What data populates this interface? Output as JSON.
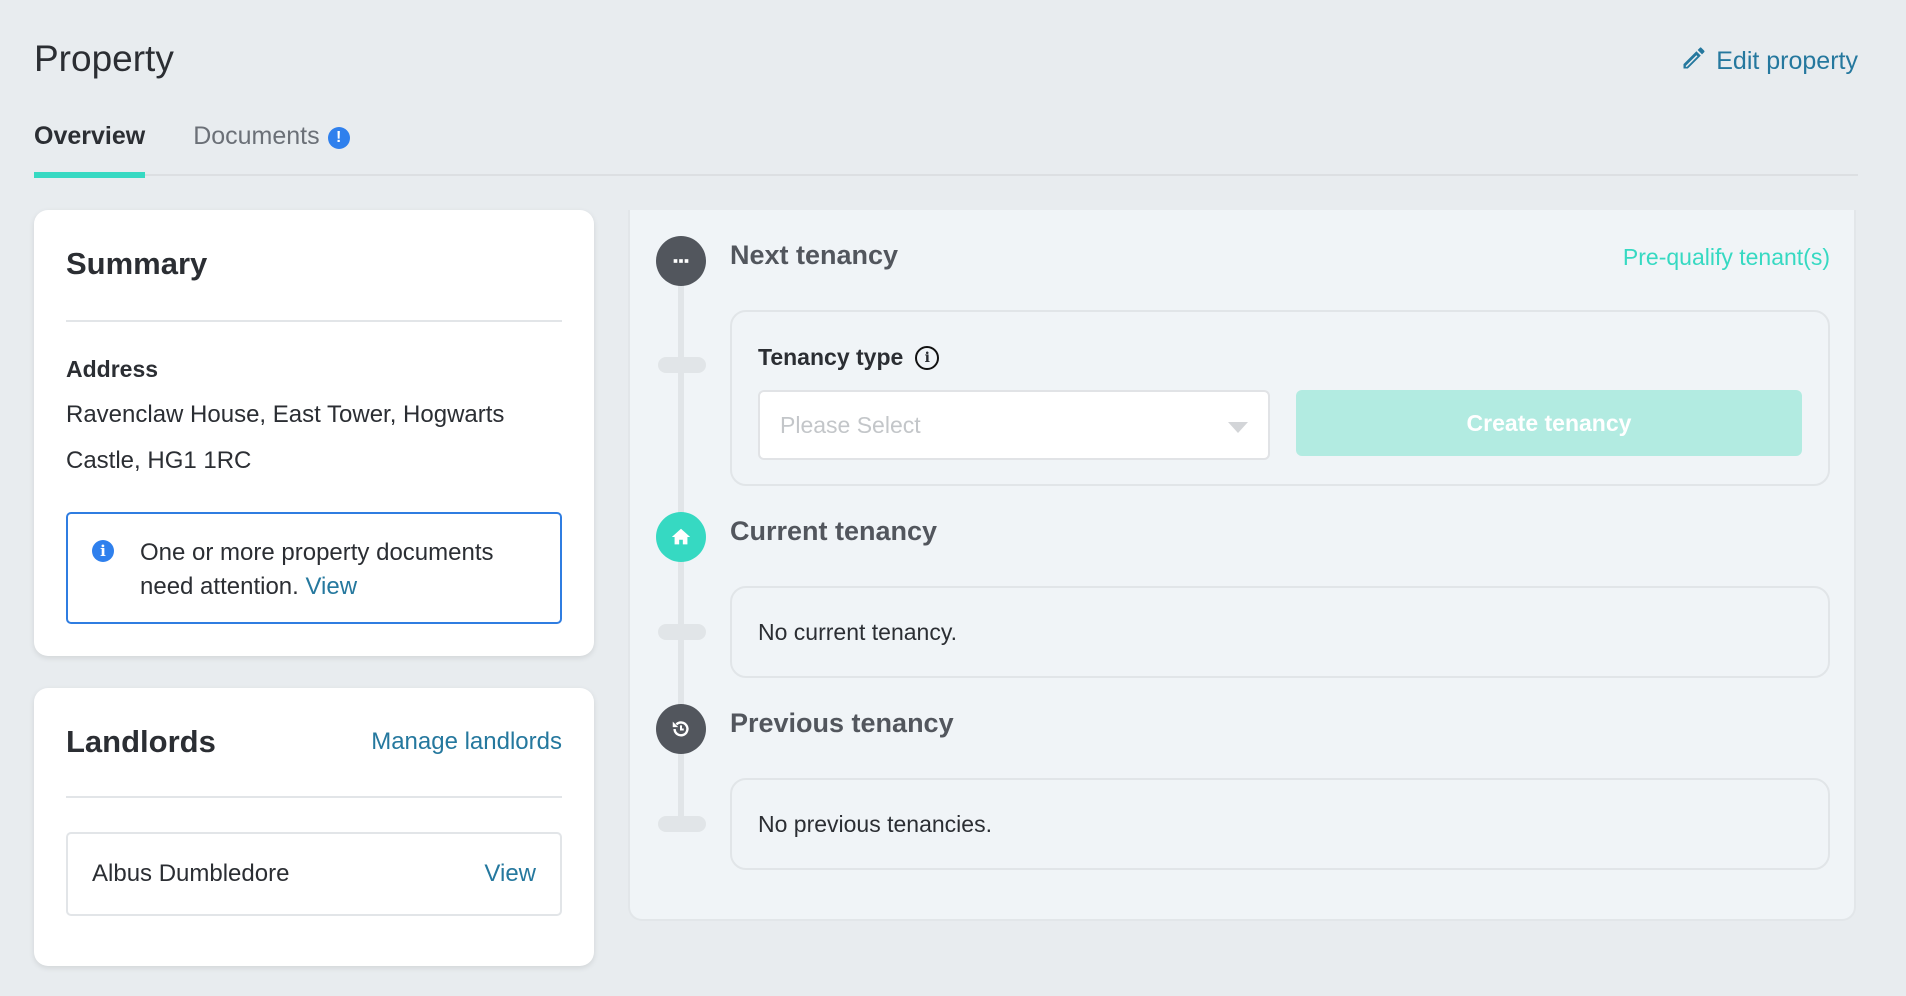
{
  "header": {
    "title": "Property",
    "edit_label": "Edit property"
  },
  "tabs": [
    {
      "label": "Overview",
      "active": true
    },
    {
      "label": "Documents",
      "active": false,
      "badge": "!"
    }
  ],
  "summary": {
    "title": "Summary",
    "address_label": "Address",
    "address_value": "Ravenclaw House, East Tower, Hogwarts Castle, HG1 1RC",
    "alert": {
      "icon": "i",
      "message": "One or more property documents need attention.",
      "link_label": "View"
    }
  },
  "landlords": {
    "title": "Landlords",
    "manage_label": "Manage landlords",
    "items": [
      {
        "name": "Albus Dumbledore",
        "action_label": "View"
      }
    ]
  },
  "timeline": {
    "next": {
      "title": "Next tenancy",
      "prequalify_label": "Pre-qualify tenant(s)",
      "tenancy_type_label": "Tenancy type",
      "info_icon": "i",
      "select_placeholder": "Please Select",
      "create_label": "Create tenancy"
    },
    "current": {
      "title": "Current tenancy",
      "empty_text": "No current tenancy."
    },
    "previous": {
      "title": "Previous tenancy",
      "empty_text": "No previous tenancies."
    }
  },
  "colors": {
    "accent": "#36d9c2",
    "link": "#25789e",
    "info": "#2f80ed",
    "disabled_button": "#b2ebe1",
    "node_dark": "#52565d",
    "background": "#e8ecef"
  }
}
